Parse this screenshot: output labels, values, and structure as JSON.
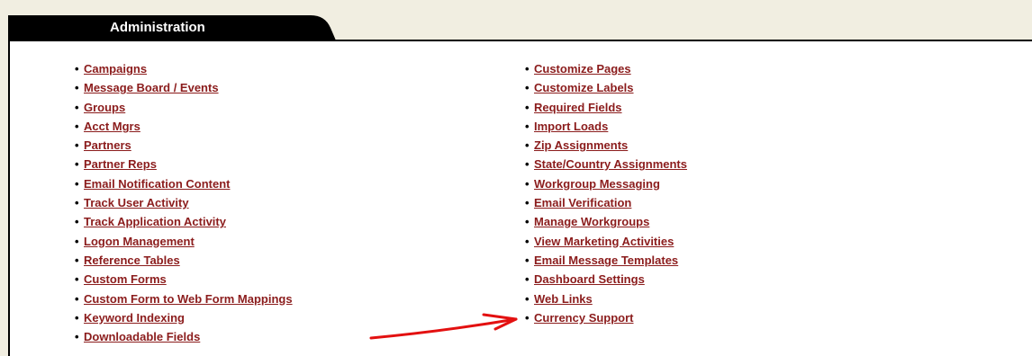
{
  "header": {
    "title": "Administration"
  },
  "colors": {
    "page_bg": "#f1eee1",
    "tab_bg": "#000000",
    "link": "#8b1c1c",
    "annotation_arrow": "#e31010"
  },
  "links_left": [
    "Campaigns",
    "Message Board / Events",
    "Groups",
    "Acct Mgrs",
    "Partners",
    "Partner Reps",
    "Email Notification Content",
    "Track User Activity",
    "Track Application Activity",
    "Logon Management",
    "Reference Tables",
    "Custom Forms",
    "Custom Form to Web Form Mappings",
    "Keyword Indexing",
    "Downloadable Fields"
  ],
  "links_right": [
    "Customize Pages",
    "Customize Labels",
    "Required Fields",
    "Import Loads",
    "Zip Assignments",
    "State/Country Assignments",
    "Workgroup Messaging",
    "Email Verification",
    "Manage Workgroups",
    "View Marketing Activities",
    "Email Message Templates",
    "Dashboard Settings",
    "Web Links",
    "Currency Support"
  ],
  "annotation": {
    "type": "red-arrow",
    "points_to": "Currency Support"
  }
}
